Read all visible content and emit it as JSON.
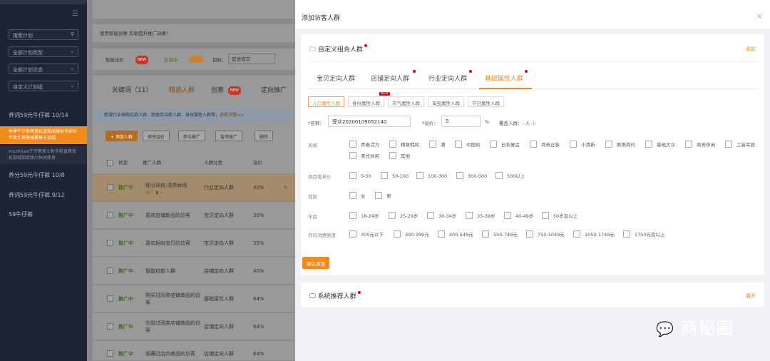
{
  "sidebar": {
    "search_placeholder": "搜索计划",
    "filters": [
      "全部计划类型",
      "全部计划状态",
      "自定义计划组"
    ],
    "plans": [
      {
        "label": "养词59元牛仔裤 10/14",
        "active": false
      },
      {
        "label": "冬季牛仔裤男宽松直筒高腰秋冬款中年男士爸爸弹裹裤子加绒",
        "active": true
      },
      {
        "label": "muzhiLee牛仔裤男士秋冬款直筒宽松加绒加厚弹力休闲修身",
        "active": false,
        "sub": true
      },
      {
        "label": "养分59元牛仔裤 10/8",
        "active": false
      },
      {
        "label": "养词59元牛仔裤 9/12",
        "active": false
      },
      {
        "label": "59牛仔裤",
        "active": false
      }
    ]
  },
  "main": {
    "banner": "使用智能创意 有助提升推广效果！",
    "smart_bid": "智能出价",
    "new_badge": "NEW",
    "status_on": "生效中",
    "target_label": "目标：",
    "target_value": "促进成交",
    "tabs": [
      "关键词（11）",
      "精选人群",
      "创意",
      "定向推广"
    ],
    "notice": "新增行业高购买欲人群、跨类目拉新人群、身份属性人群等，",
    "notice_link": "查看详情>>",
    "buttons": [
      "+ 添加人群",
      "修改溢价",
      "参与推广",
      "暂停推广",
      "删除"
    ],
    "headers": [
      "状态",
      "推广人群",
      "人群分类",
      "溢价"
    ],
    "rows": [
      {
        "status": "推广中",
        "name": "细分风格:清务休闲",
        "cat": "行业定向人群",
        "pct": "40%",
        "hl": true
      },
      {
        "status": "推广中",
        "name": "喜欢店铺新品的访客",
        "cat": "宝贝定向人群",
        "pct": "30%"
      },
      {
        "status": "推广中",
        "name": "喜欢相似宝贝的访客",
        "cat": "宝贝定向人群",
        "pct": "35%"
      },
      {
        "status": "推广中",
        "name": "智能拉新人群",
        "cat": "店铺定向人群",
        "pct": "40%"
      },
      {
        "status": "推广中",
        "name": "购买过同类店铺商品的访客",
        "cat": "基础属性人群",
        "pct": "64%"
      },
      {
        "status": "推广中",
        "name": "浏览过同类店铺商品的访客",
        "cat": "店铺定向人群",
        "pct": "64%"
      },
      {
        "status": "推广中",
        "name": "收藏过店内商品的访客",
        "cat": "店铺定向人群",
        "pct": "64%"
      }
    ]
  },
  "panel": {
    "title": "添加访客人群",
    "close": "×",
    "custom_title": "自定义组合人群",
    "collapse": "收起",
    "tabs": [
      "宝贝定向人群",
      "店铺定向人群",
      "行业定向人群",
      "基础属性人群"
    ],
    "subtabs": [
      "人口属性人群",
      "身份属性人群",
      "天气属性人群",
      "淘宝属性人群",
      "节日属性人群"
    ],
    "subtab_new": "NEW",
    "name_label": "*名称：",
    "name_value": "受众20200109052140",
    "premium_label": "*溢价：",
    "premium_value": "5",
    "percent": "%",
    "coverage": "覆盖人群：- 人 ⓘ",
    "style_label": "风格",
    "style_options": [
      "青春活力",
      "精致韩风",
      "潮",
      "中国风",
      "日系复古",
      "商务正装",
      "小清新",
      "欧美简约",
      "基础大众",
      "商务休闲",
      "工装军旅",
      "美式休闲",
      "其他"
    ],
    "price_label": "类目笔单价",
    "price_options": [
      "0-50",
      "50-100",
      "100-300",
      "300-500",
      "500以上"
    ],
    "gender_label": "性别",
    "gender_options": [
      "女",
      "男"
    ],
    "age_label": "年龄",
    "age_options": [
      "18-24岁",
      "25-29岁",
      "30-34岁",
      "35-39岁",
      "40-49岁",
      "50岁及以上"
    ],
    "spend_label": "月均消费额度",
    "spend_options": [
      "300元以下",
      "300-399元",
      "400-549元",
      "550-749元",
      "750-1049元",
      "1050-1749元",
      "1750元及以上"
    ],
    "confirm": "确认添加",
    "system_title": "系统推荐人群",
    "expand": "展开"
  },
  "watermark": "商秘圈"
}
